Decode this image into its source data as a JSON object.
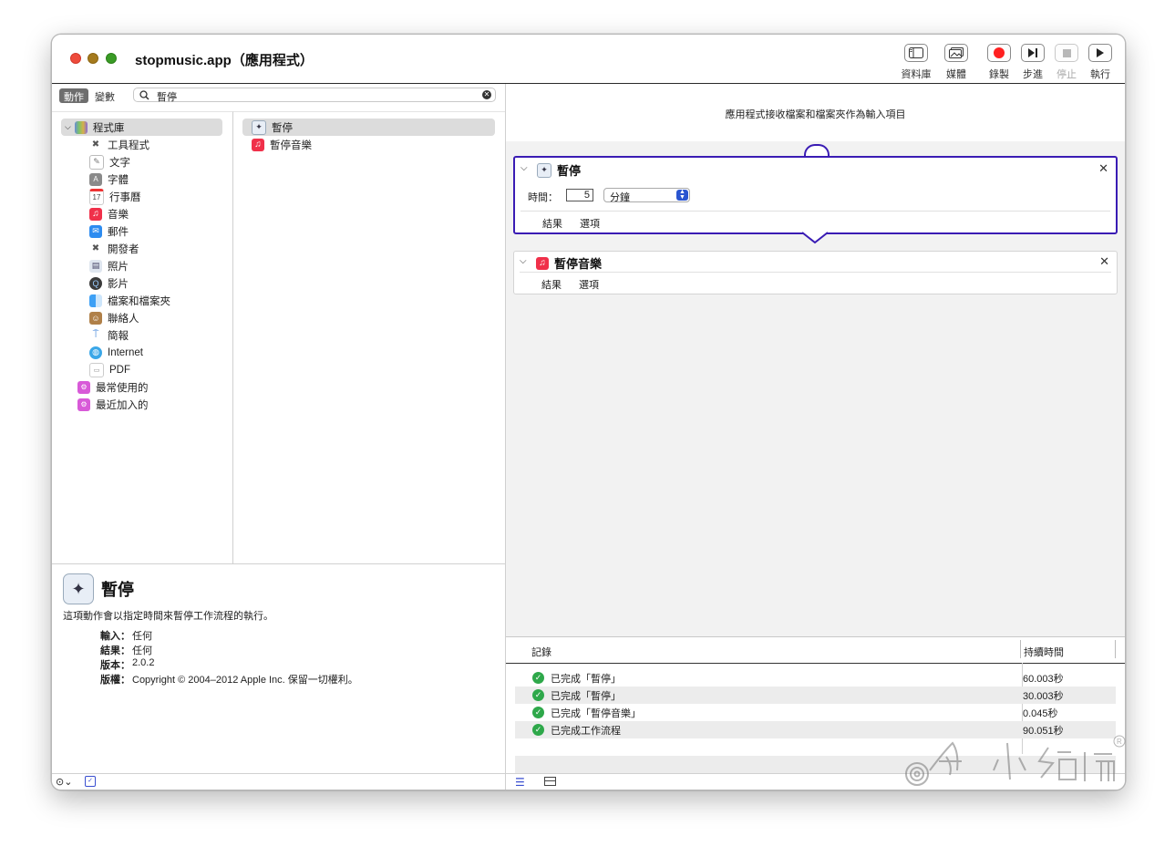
{
  "window": {
    "title": "stopmusic.app（應用程式）"
  },
  "toolbar": {
    "library_label": "資料庫",
    "media_label": "媒體",
    "record_label": "錄製",
    "step_label": "步進",
    "stop_label": "停止",
    "run_label": "執行"
  },
  "left": {
    "seg_actions": "動作",
    "seg_variables": "變數",
    "search_value": "暫停",
    "library_root": "程式庫",
    "library_items": [
      "工具程式",
      "文字",
      "字體",
      "行事曆",
      "音樂",
      "郵件",
      "開發者",
      "照片",
      "影片",
      "檔案和檔案夾",
      "聯絡人",
      "簡報",
      "Internet",
      "PDF"
    ],
    "smart_groups": [
      "最常使用的",
      "最近加入的"
    ],
    "actions": [
      "暫停",
      "暫停音樂"
    ]
  },
  "description": {
    "title": "暫停",
    "text": "這項動作會以指定時間來暫停工作流程的執行。",
    "input_k": "輸入：",
    "input_v": "任何",
    "result_k": "結果：",
    "result_v": "任何",
    "version_k": "版本：",
    "version_v": "2.0.2",
    "copyright_k": "版權：",
    "copyright_v": "Copyright © 2004–2012 Apple Inc. 保留一切權利。"
  },
  "workflow": {
    "header": "應用程式接收檔案和檔案夾作為輸入項目",
    "card1": {
      "title": "暫停",
      "time_label": "時間：",
      "time_value": "5",
      "unit": "分鐘",
      "results": "結果",
      "options": "選項"
    },
    "card2": {
      "title": "暫停音樂",
      "results": "結果",
      "options": "選項"
    }
  },
  "log": {
    "col_log": "記錄",
    "col_duration": "持續時間",
    "rows": [
      {
        "text": "已完成「暫停」",
        "duration": "60.003秒"
      },
      {
        "text": "已完成「暫停」",
        "duration": "30.003秒"
      },
      {
        "text": "已完成「暫停音樂」",
        "duration": "0.045秒"
      },
      {
        "text": "已完成工作流程",
        "duration": "90.051秒"
      }
    ]
  },
  "icons": {
    "library": "sidebar-icon",
    "media": "photo-icon",
    "record": "record-icon",
    "step": "step-forward-icon",
    "stop": "stop-icon",
    "run": "play-icon"
  },
  "colors": {
    "selected_border": "#3a1cb4",
    "record_red": "#ff2020",
    "success_green": "#2ea84a"
  }
}
